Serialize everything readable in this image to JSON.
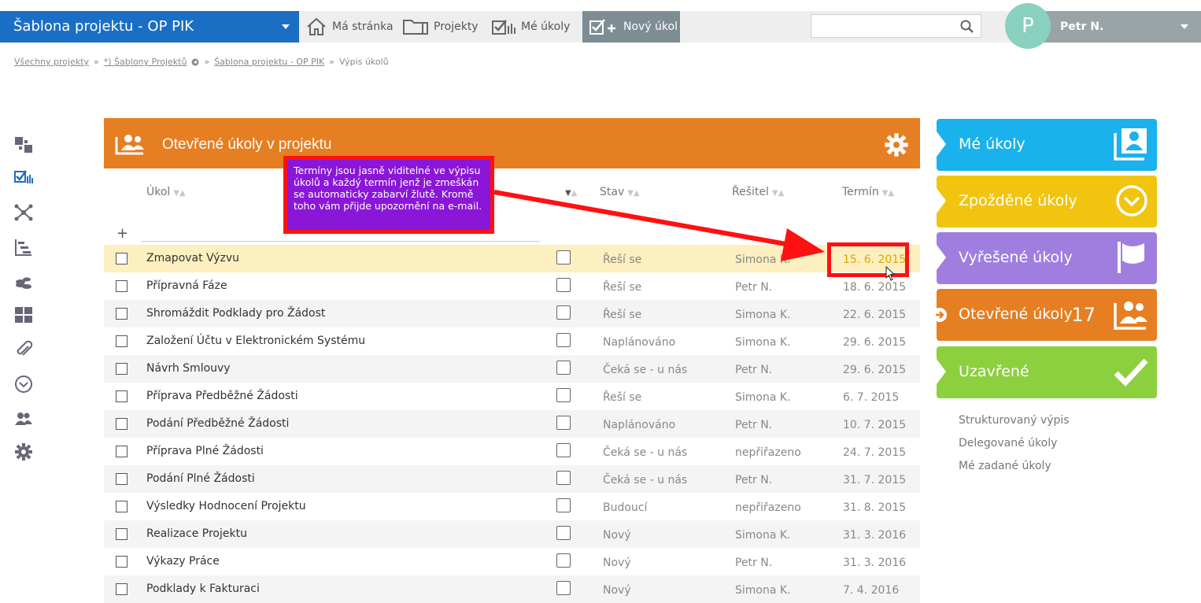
{
  "header": {
    "project_title": "Šablona projektu - OP PIK",
    "nav": {
      "my_page": "Má stránka",
      "projects": "Projekty",
      "my_tasks": "Mé úkoly",
      "new_task": "Nový úkol"
    },
    "search_placeholder": "",
    "avatar_letter": "P",
    "user_name": "Petr N."
  },
  "breadcrumb": {
    "all_projects": "Všechny projekty",
    "templates": "*) Šablony Projektů",
    "project": "Šablona projektu - OP PIK",
    "current": "Výpis úkolů",
    "separator": "»"
  },
  "panel": {
    "title": "Otevřené úkoly v projektu",
    "columns": {
      "task": "Úkol",
      "state": "Stav",
      "assignee": "Řešitel",
      "deadline": "Termín"
    },
    "add_symbol": "+"
  },
  "rows": [
    {
      "name": "Zmapovat Výzvu",
      "state": "Řeší se",
      "assignee": "Simona K.",
      "deadline": "15. 6. 2015",
      "overdue": true
    },
    {
      "name": "Přípravná Fáze",
      "state": "Řeší se",
      "assignee": "Petr N.",
      "deadline": "18. 6. 2015"
    },
    {
      "name": "Shromáždit Podklady pro Žádost",
      "state": "Řeší se",
      "assignee": "Simona K.",
      "deadline": "22. 6. 2015"
    },
    {
      "name": "Založení Účtu v Elektronickém Systému",
      "state": "Naplánováno",
      "assignee": "Simona K.",
      "deadline": "29. 6. 2015"
    },
    {
      "name": "Návrh Smlouvy",
      "state": "Čeká se - u nás",
      "assignee": "Petr N.",
      "deadline": "29. 6. 2015"
    },
    {
      "name": "Příprava Předběžné Žádosti",
      "state": "Řeší se",
      "assignee": "Simona K.",
      "deadline": "6. 7. 2015"
    },
    {
      "name": "Podání Předběžné Žádosti",
      "state": "Naplánováno",
      "assignee": "Petr N.",
      "deadline": "10. 7. 2015"
    },
    {
      "name": "Příprava Plné Žádosti",
      "state": "Čeká se - u nás",
      "assignee": "nepřiřazeno",
      "deadline": "24. 7. 2015"
    },
    {
      "name": "Podání Plné Žádosti",
      "state": "Čeká se - u nás",
      "assignee": "Petr N.",
      "deadline": "31. 7. 2015"
    },
    {
      "name": "Výsledky Hodnocení Projektu",
      "state": "Budoucí",
      "assignee": "nepřiřazeno",
      "deadline": "31. 8. 2015"
    },
    {
      "name": "Realizace Projektu",
      "state": "Nový",
      "assignee": "Simona K.",
      "deadline": "31. 3. 2016"
    },
    {
      "name": "Výkazy Práce",
      "state": "Nový",
      "assignee": "Petr N.",
      "deadline": "31. 3. 2016"
    },
    {
      "name": "Podklady k Fakturaci",
      "state": "Nový",
      "assignee": "Simona K.",
      "deadline": "7. 4. 2016"
    }
  ],
  "tiles": [
    {
      "label": "Mé úkoly",
      "color": "#1ab2ec",
      "icon": "assignee-icon"
    },
    {
      "label": "Zpožděné úkoly",
      "color": "#f1c40f",
      "icon": "clock-icon"
    },
    {
      "label": "Vyřešené úkoly",
      "color": "#a07ee0",
      "icon": "flag-icon"
    },
    {
      "label": "Otevřené úkoly",
      "color": "#e67e22",
      "icon": "people-icon",
      "count": "17"
    },
    {
      "label": "Uzavřené",
      "color": "#8ccf3f",
      "icon": "checkmark-icon"
    }
  ],
  "side_links": {
    "structured": "Strukturovaný výpis",
    "delegated": "Delegované úkoly",
    "assigned_by_me": "Mé zadané úkoly"
  },
  "annotation": {
    "text": "Termíny jsou jasně viditelné ve výpisu úkolů a každý termín jenž je zmeškán se automaticky zabarví žlutě. Kromě toho vám přijde upozornění na e-mail."
  }
}
